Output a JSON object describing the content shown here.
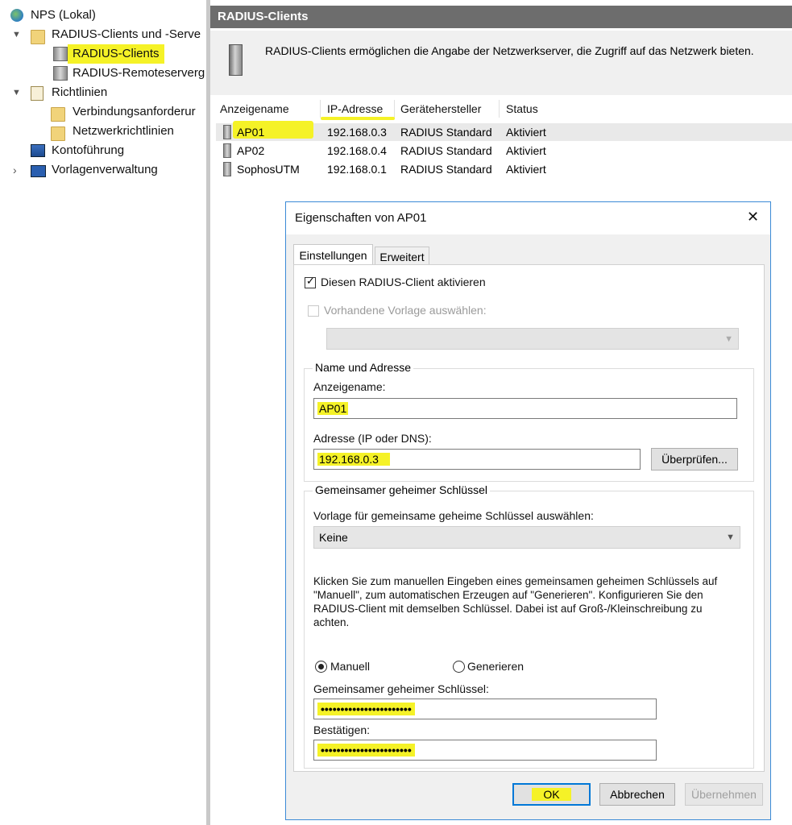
{
  "tree": {
    "items": [
      {
        "label": "NPS (Lokal)"
      },
      {
        "label": "RADIUS-Clients und -Serve"
      },
      {
        "label": "RADIUS-Clients"
      },
      {
        "label": "RADIUS-Remoteserverg"
      },
      {
        "label": "Richtlinien"
      },
      {
        "label": "Verbindungsanforderur"
      },
      {
        "label": "Netzwerkrichtlinien"
      },
      {
        "label": "Kontoführung"
      },
      {
        "label": "Vorlagenverwaltung"
      }
    ]
  },
  "main": {
    "header": "RADIUS-Clients",
    "description": "RADIUS-Clients ermöglichen die Angabe der Netzwerkserver, die Zugriff auf das Netzwerk bieten.",
    "columns": [
      "Anzeigename",
      "IP-Adresse",
      "Gerätehersteller",
      "Status"
    ],
    "rows": [
      {
        "name": "AP01",
        "ip": "192.168.0.3",
        "vendor": "RADIUS Standard",
        "status": "Aktiviert"
      },
      {
        "name": "AP02",
        "ip": "192.168.0.4",
        "vendor": "RADIUS Standard",
        "status": "Aktiviert"
      },
      {
        "name": "SophosUTM",
        "ip": "192.168.0.1",
        "vendor": "RADIUS Standard",
        "status": "Aktiviert"
      }
    ]
  },
  "dialog": {
    "title": "Eigenschaften von AP01",
    "close_glyph": "✕",
    "tabs": [
      "Einstellungen",
      "Erweitert"
    ],
    "enable_label": "Diesen RADIUS-Client aktivieren",
    "template_label": "Vorhandene Vorlage auswählen:",
    "template_value": "",
    "group_name_address": "Name und Adresse",
    "display_name_label": "Anzeigename:",
    "display_name_value": "AP01",
    "address_label": "Adresse (IP oder DNS):",
    "address_value": "192.168.0.3",
    "verify_button": "Überprüfen...",
    "group_secret": "Gemeinsamer geheimer Schlüssel",
    "secret_template_label": "Vorlage für gemeinsame geheime Schlüssel auswählen:",
    "secret_template_value": "Keine",
    "help_text": [
      "Klicken Sie zum manuellen Eingeben eines gemeinsamen geheimen Schlüssels auf",
      "\"Manuell\", zum automatischen Erzeugen auf \"Generieren\". Konfigurieren Sie den",
      "RADIUS-Client mit demselben Schlüssel. Dabei ist auf Groß-/Kleinschreibung zu",
      "achten."
    ],
    "radio_manual": "Manuell",
    "radio_generate": "Generieren",
    "secret_label": "Gemeinsamer geheimer Schlüssel:",
    "secret_value": "•••••••••••••••••••••••",
    "confirm_label": "Bestätigen:",
    "confirm_value": "•••••••••••••••••••••••",
    "ok_button": "OK",
    "cancel_button": "Abbrechen",
    "apply_button": "Übernehmen"
  }
}
